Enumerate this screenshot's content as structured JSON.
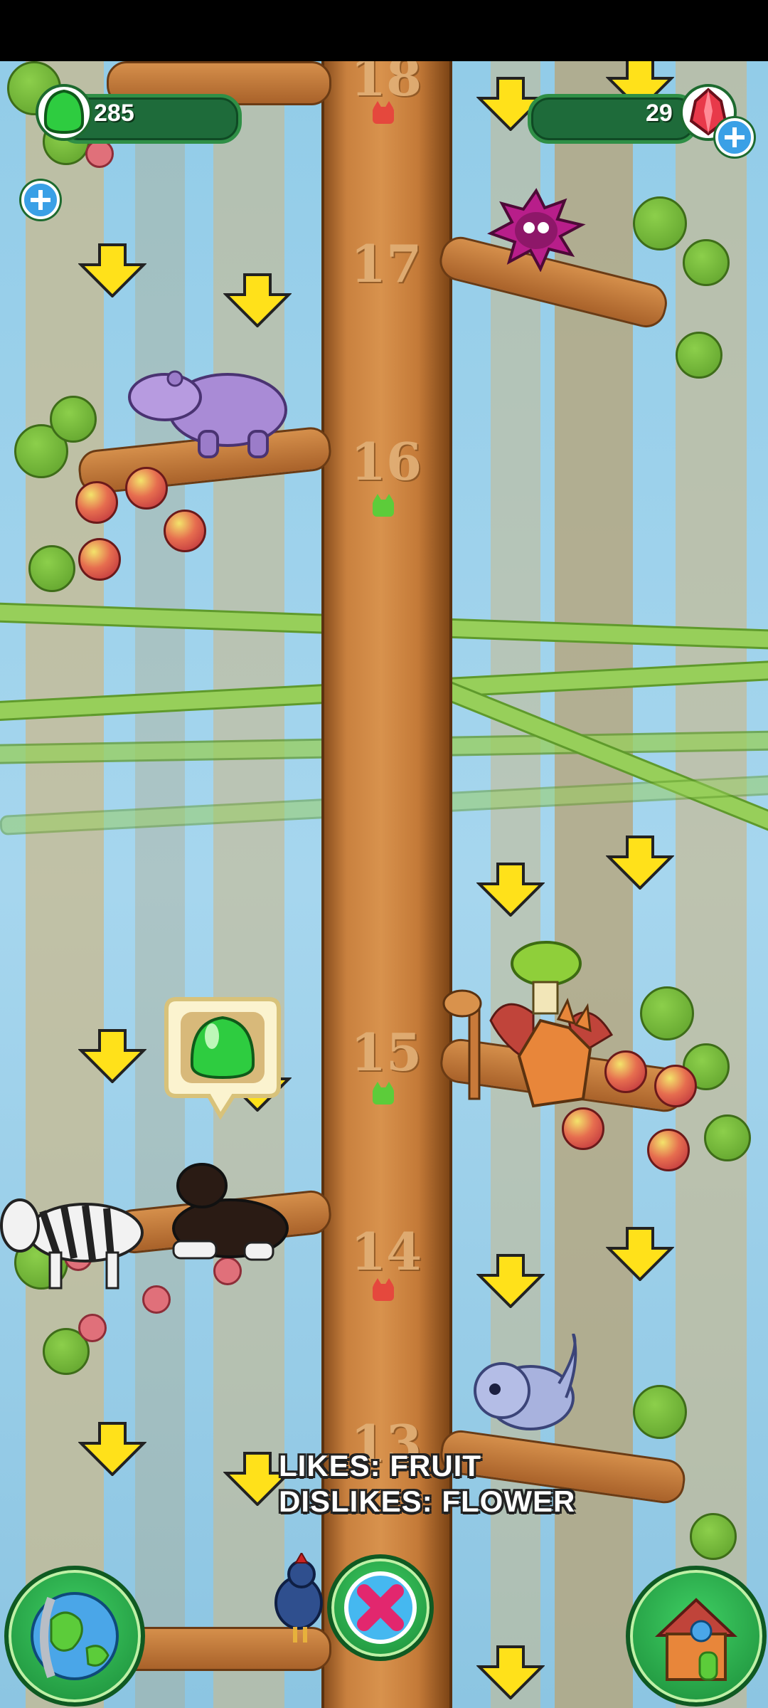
{
  "hud": {
    "gems_green": "285",
    "gems_red": "29"
  },
  "tree": {
    "floors": [
      "18",
      "17",
      "16",
      "15",
      "14",
      "13"
    ]
  },
  "animal_info": {
    "likes": "LIKES: FRUIT",
    "dislikes": "DISLIKES: FLOWER"
  },
  "buttons": {
    "map": "globe-icon",
    "cancel": "close-x-icon",
    "home": "house-icon"
  },
  "colors": {
    "arrow": "#ffe11a",
    "hud_green": "#1e6b3a",
    "gem_green": "#2ecc40",
    "gem_red": "#e8394a",
    "marker_red": "#e5483d",
    "marker_green": "#5ccc3a"
  }
}
